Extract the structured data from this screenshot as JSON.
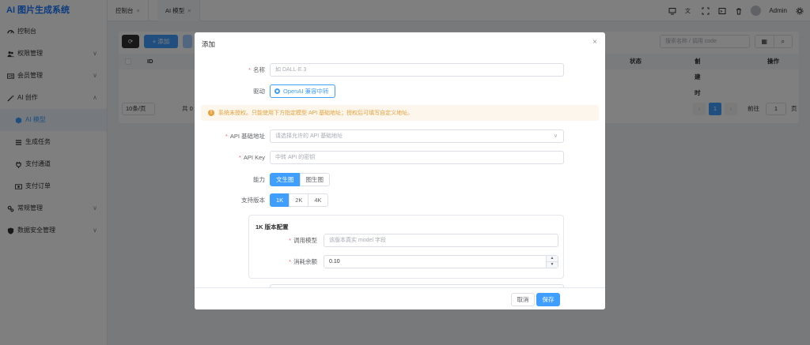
{
  "app": {
    "title": "AI 图片生成系统",
    "accent_color": "#409eff",
    "logo_color": "#1677ff"
  },
  "sidebar": {
    "items": [
      {
        "label": "控制台",
        "icon": "dashboard-icon"
      },
      {
        "label": "权限管理",
        "icon": "users-icon",
        "arrow": "∨"
      },
      {
        "label": "会员管理",
        "icon": "id-card-icon",
        "arrow": "∨"
      },
      {
        "label": "AI 创作",
        "icon": "magic-wand-icon",
        "arrow": "∧"
      },
      {
        "label": "AI 模型",
        "icon": "cube-icon",
        "active": true
      },
      {
        "label": "生成任务",
        "icon": "list-icon"
      },
      {
        "label": "支付通道",
        "icon": "plug-icon"
      },
      {
        "label": "支付订单",
        "icon": "money-icon"
      },
      {
        "label": "常规管理",
        "icon": "settings-icon",
        "arrow": "∨"
      },
      {
        "label": "数据安全管理",
        "icon": "shield-icon",
        "arrow": "∨"
      }
    ]
  },
  "topbar": {
    "tabs": [
      {
        "label": "控制台",
        "close": "×"
      },
      {
        "label": "AI 模型",
        "close": "×"
      }
    ],
    "user": "Admin"
  },
  "background": {
    "add_label": "添加",
    "search_placeholder": "搜索名称 / 调用 code",
    "columns": [
      "ID",
      "状态",
      "创建时间",
      "操作"
    ],
    "sort_mark": "⇕",
    "page_size": "10条/页",
    "total_prefix": "共 0",
    "page": "1",
    "goto_label": "前往",
    "goto_value": "1",
    "page_suffix": "页"
  },
  "dialog": {
    "title": "添加",
    "close": "×",
    "fields": {
      "name": {
        "label": "名称",
        "placeholder": "如 DALL·E 3"
      },
      "driver": {
        "label": "驱动",
        "value": "OpenAI 兼容中转"
      },
      "api_base": {
        "label": "API 基础地址",
        "placeholder": "请选择允许的 API 基础地址"
      },
      "api_key": {
        "label": "API Key",
        "placeholder": "中转 API 的密钥"
      },
      "capability": {
        "label": "能力",
        "options": [
          "文生图",
          "图生图"
        ],
        "selected": "文生图"
      },
      "versions": {
        "label": "支持版本",
        "options": [
          "1K",
          "2K",
          "4K"
        ],
        "selected": "1K"
      }
    },
    "alert": "系统未授权。只能使用下方指定模型 API 基础地址；授权后可填写自定义地址。",
    "alert_icon": "!",
    "version_card": {
      "title": "1K 版本配置",
      "model_label": "调用模型",
      "model_placeholder": "该版本真实 model 字段",
      "cost_label": "消耗余额",
      "cost_value": "0.10"
    },
    "cancel_label": "取消",
    "save_label": "保存"
  }
}
